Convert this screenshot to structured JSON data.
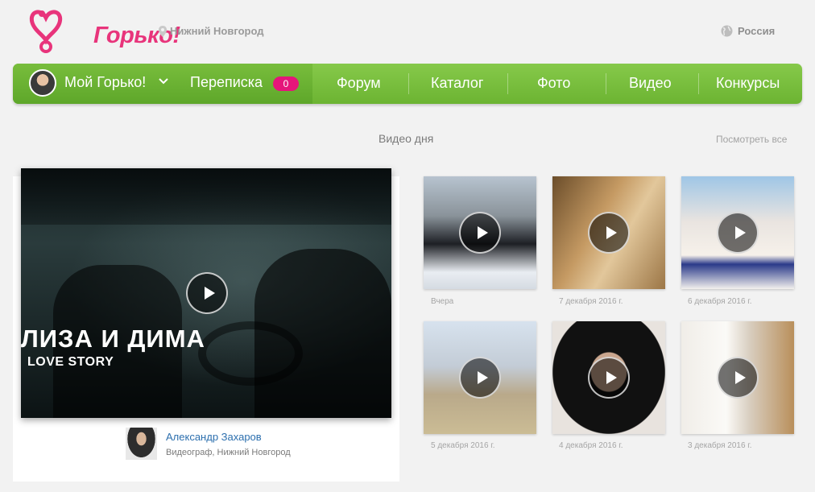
{
  "header": {
    "logo_text": "Горько!",
    "city": "Нижний Новгород",
    "region": "Россия"
  },
  "nav": {
    "my_gorko": "Мой Горько!",
    "messages": "Переписка",
    "messages_count": "0",
    "links": [
      "Форум",
      "Каталог",
      "Фото",
      "Видео",
      "Конкурсы"
    ]
  },
  "section": {
    "title": "Видео дня",
    "see_all": "Посмотреть все"
  },
  "featured": {
    "title": "ЛИЗА И ДИМА",
    "subtitle": "LOVE STORY",
    "author_name": "Александр Захаров",
    "author_role": "Видеограф, Нижний Новгород"
  },
  "videos": [
    {
      "date": "Вчера"
    },
    {
      "date": "7 декабря 2016 г."
    },
    {
      "date": "6 декабря 2016 г."
    },
    {
      "date": "5 декабря 2016 г."
    },
    {
      "date": "4 декабря 2016 г."
    },
    {
      "date": "3 декабря 2016 г."
    }
  ],
  "colors": {
    "brand_pink": "#e8347b",
    "nav_green": "#78bd3c",
    "badge": "#e5157a",
    "link_blue": "#2c6fae"
  }
}
